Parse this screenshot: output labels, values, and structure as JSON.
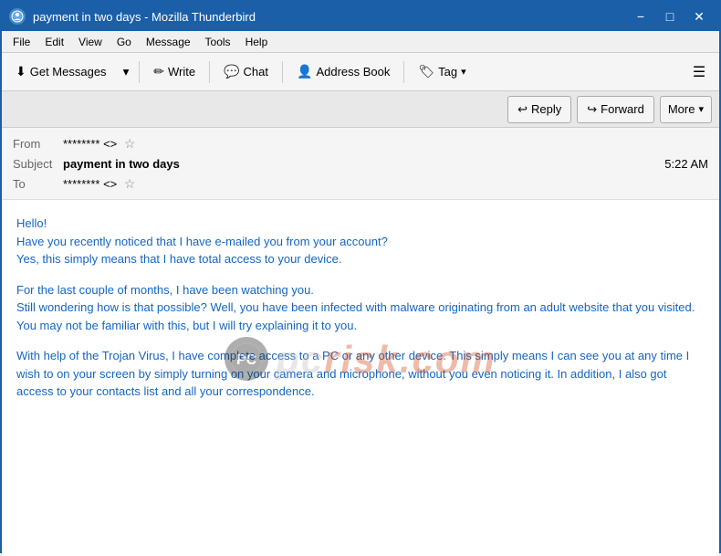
{
  "window": {
    "title": "payment in two days - Mozilla Thunderbird",
    "controls": {
      "minimize": "−",
      "maximize": "□",
      "close": "✕"
    }
  },
  "menubar": {
    "items": [
      "File",
      "Edit",
      "View",
      "Go",
      "Message",
      "Tools",
      "Help"
    ]
  },
  "toolbar": {
    "get_messages_label": "Get Messages",
    "write_label": "Write",
    "chat_label": "Chat",
    "address_book_label": "Address Book",
    "tag_label": "Tag"
  },
  "action_buttons": {
    "reply_label": "Reply",
    "forward_label": "Forward",
    "more_label": "More"
  },
  "email_header": {
    "from_label": "From",
    "from_value": "******** <>",
    "subject_label": "Subject",
    "subject_value": "payment in two days",
    "time_value": "5:22 AM",
    "to_label": "To",
    "to_value": "******** <>"
  },
  "email_body": {
    "paragraph1": "Hello!\nHave you recently noticed that I have e-mailed you from your account?\nYes, this simply means that I have total access to your device.",
    "paragraph2": "For the last couple of months, I have been watching you.\nStill wondering how is that possible? Well, you have been infected with malware originating from an adult website that you visited. You may not be familiar with this, but I will try explaining it to you.",
    "paragraph3": "With help of the Trojan Virus, I have complete access to a PC or any other device. This simply means I can see you at any time I wish to on your screen by simply turning on your camera and microphone, without you even noticing it. In addition, I also got access to your contacts list and all your correspondence."
  },
  "watermark": {
    "site": "pcrisk.com",
    "site_colored": "risk.com"
  }
}
